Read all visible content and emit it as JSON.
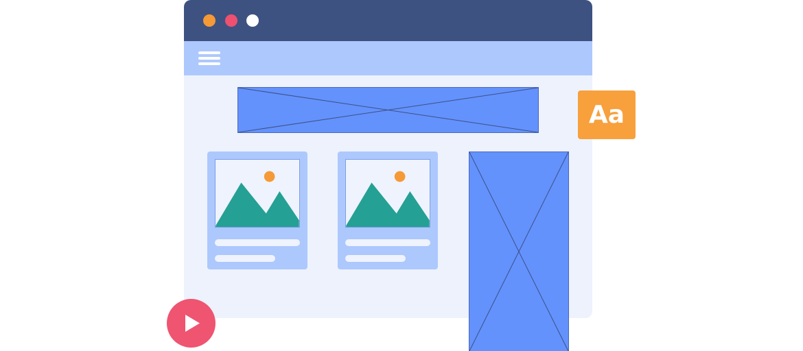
{
  "window": {
    "controls": [
      "close",
      "minimize",
      "maximize"
    ]
  },
  "font_badge": {
    "label": "Aa"
  },
  "icons": {
    "menu": "hamburger-menu-icon",
    "play": "play-icon",
    "image": "image-placeholder-icon"
  },
  "colors": {
    "titlebar": "#3e5281",
    "navbar": "#adc8fd",
    "page_background": "#edf2fd",
    "placeholder_fill": "#6392fc",
    "accent_orange": "#f7a03c",
    "accent_red": "#ef5470",
    "mountain_green": "#25a094"
  }
}
